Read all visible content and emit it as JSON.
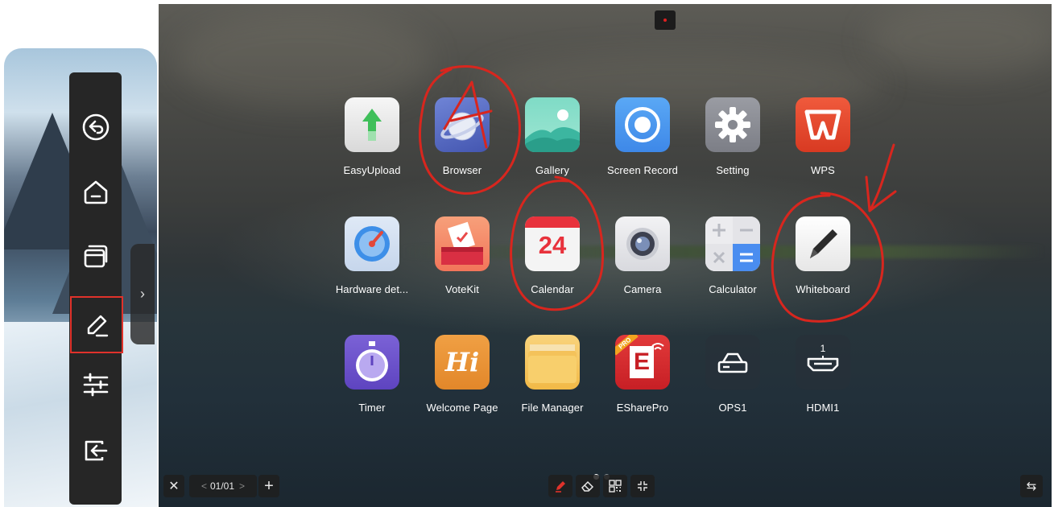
{
  "left_panel": {
    "toolbar": [
      {
        "name": "back-icon",
        "label": ""
      },
      {
        "name": "home-icon",
        "label": ""
      },
      {
        "name": "recent-apps-icon",
        "label": ""
      },
      {
        "name": "annotation-pen-icon",
        "label": "",
        "highlighted": true
      },
      {
        "name": "settings-sliders-icon",
        "label": ""
      },
      {
        "name": "input-source-icon",
        "label": ""
      }
    ],
    "expand_glyph": "›"
  },
  "apps": [
    {
      "label": "EasyUpload",
      "icon": "upload-arrow-icon"
    },
    {
      "label": "Browser",
      "icon": "browser-planet-icon"
    },
    {
      "label": "Gallery",
      "icon": "gallery-landscape-icon"
    },
    {
      "label": "Screen Record",
      "icon": "screen-record-icon"
    },
    {
      "label": "Setting",
      "icon": "gear-icon"
    },
    {
      "label": "WPS",
      "icon": "wps-logo-icon"
    },
    {
      "label": "Hardware det...",
      "icon": "gauge-icon"
    },
    {
      "label": "VoteKit",
      "icon": "ballot-box-icon"
    },
    {
      "label": "Calendar",
      "icon": "calendar-icon",
      "day": "24"
    },
    {
      "label": "Camera",
      "icon": "camera-lens-icon"
    },
    {
      "label": "Calculator",
      "icon": "calculator-icon"
    },
    {
      "label": "Whiteboard",
      "icon": "whiteboard-pen-icon"
    },
    {
      "label": "Timer",
      "icon": "stopwatch-icon"
    },
    {
      "label": "Welcome Page",
      "icon": "welcome-hi-icon",
      "glyph": "Hi"
    },
    {
      "label": "File Manager",
      "icon": "folder-icon"
    },
    {
      "label": "ESharePro",
      "icon": "eshare-icon",
      "glyph": "E",
      "badge": "PRO"
    },
    {
      "label": "OPS1",
      "icon": "ops-device-icon"
    },
    {
      "label": "HDMI1",
      "icon": "hdmi-port-icon",
      "glyph": "1"
    }
  ],
  "bottom_bar": {
    "page_indicator": "01/01",
    "prev_glyph": "<",
    "next_glyph": ">",
    "close_glyph": "✕",
    "add_glyph": "+",
    "swap_glyph": "⇆"
  },
  "colors": {
    "annotation_red": "#d8261e",
    "highlight_box": "#e0322b"
  }
}
